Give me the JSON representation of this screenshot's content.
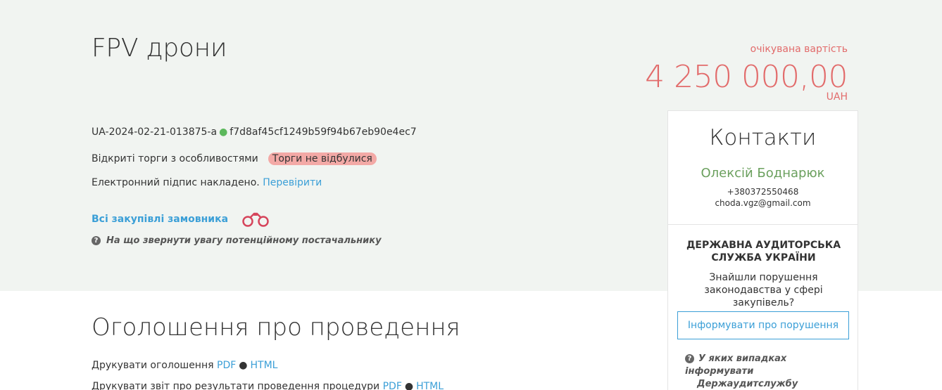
{
  "tender": {
    "title": "FPV дрони",
    "expected_label": "очікувана вартість",
    "amount": "4 250 000,00",
    "currency": "UAH",
    "tender_id": "UA-2024-02-21-013875-a",
    "hash": "f7d8af45cf1249b59f94b67eb90e4ec7",
    "procedure": "Відкриті торги з особливостями",
    "status": "Торги не відбулися",
    "signature_text": "Електронний підпис накладено.",
    "verify_link": "Перевірити",
    "all_purchases_link": "Всі закупівлі замовника",
    "attention_text": "На що звернути увагу потенційному постачальнику"
  },
  "announcement": {
    "title": "Оголошення про проведення",
    "print_notice_label": "Друкувати оголошення",
    "print_report_label": "Друкувати звіт про результати проведення процедури",
    "pdf": "PDF",
    "html": "HTML",
    "separator": "●"
  },
  "contacts": {
    "title": "Контакти",
    "name": "Олексій Боднарюк",
    "phone": "+380372550468",
    "email": "choda.vgz@gmail.com"
  },
  "audit": {
    "title": "Державна аудиторська служба України",
    "question": "Знайшли порушення законодавства у сфері закупівель?",
    "button": "Інформувати про порушення",
    "help_line1": "У яких випадках інформувати",
    "help_line2": "Держаудитслужбу"
  },
  "colors": {
    "accent": "#3b9fd7",
    "amount": "#e26b6b",
    "name": "#6ba05e",
    "status_badge": "#f3a9a6"
  }
}
